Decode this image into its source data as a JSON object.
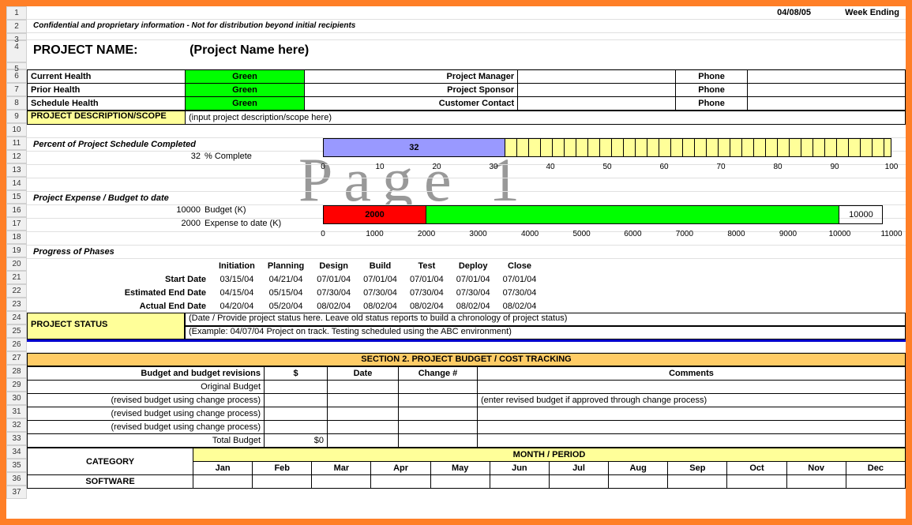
{
  "header": {
    "date": "04/08/05",
    "week_ending": "Week Ending",
    "confidential": "Confidential and proprietary information - Not for distribution beyond initial recipients",
    "project_name_label": "PROJECT NAME:",
    "project_name_value": "(Project Name here)"
  },
  "health": {
    "rows": [
      {
        "label": "Current Health",
        "value": "Green",
        "r_label": "Project Manager",
        "phone": "Phone"
      },
      {
        "label": "Prior Health",
        "value": "Green",
        "r_label": "Project Sponsor",
        "phone": "Phone"
      },
      {
        "label": "Schedule Health",
        "value": "Green",
        "r_label": "Customer Contact",
        "phone": "Phone"
      }
    ]
  },
  "description": {
    "label": "PROJECT DESCRIPTION/SCOPE",
    "value": "(input project description/scope here)"
  },
  "schedule": {
    "label": "Percent of Project Schedule Completed",
    "percent": "32",
    "complete_label": "% Complete",
    "ticks": [
      "0",
      "10",
      "20",
      "30",
      "40",
      "50",
      "60",
      "70",
      "80",
      "90",
      "100"
    ]
  },
  "budget": {
    "label": "Project Expense / Budget to date",
    "budget_val": "10000",
    "budget_lbl": "Budget (K)",
    "expense_val": "2000",
    "expense_lbl": "Expense to date (K)",
    "bar_exp": "2000",
    "bar_bud": "10000",
    "ticks": [
      "0",
      "1000",
      "2000",
      "3000",
      "4000",
      "5000",
      "6000",
      "7000",
      "8000",
      "9000",
      "10000",
      "11000"
    ]
  },
  "phases": {
    "label": "Progress of Phases",
    "headers": [
      "Initiation",
      "Planning",
      "Design",
      "Build",
      "Test",
      "Deploy",
      "Close"
    ],
    "rows": [
      {
        "label": "Start Date",
        "vals": [
          "03/15/04",
          "04/21/04",
          "07/01/04",
          "07/01/04",
          "07/01/04",
          "07/01/04",
          "07/01/04"
        ]
      },
      {
        "label": "Estimated End Date",
        "vals": [
          "04/15/04",
          "05/15/04",
          "07/30/04",
          "07/30/04",
          "07/30/04",
          "07/30/04",
          "07/30/04"
        ]
      },
      {
        "label": "Actual End Date",
        "vals": [
          "04/20/04",
          "05/20/04",
          "08/02/04",
          "08/02/04",
          "08/02/04",
          "08/02/04",
          "08/02/04"
        ]
      }
    ]
  },
  "status": {
    "label": "PROJECT STATUS",
    "line1": "(Date / Provide project status here.  Leave old status reports to build a chronology of project status)",
    "line2": "(Example:  04/07/04 Project on track.  Testing scheduled using the ABC environment)"
  },
  "section2": {
    "title": "SECTION 2.  PROJECT BUDGET / COST TRACKING",
    "headers": {
      "a": "Budget and budget revisions",
      "b": "$",
      "c": "Date",
      "d": "Change #",
      "e": "Comments"
    },
    "rows": [
      {
        "label": "Original Budget"
      },
      {
        "label": "(revised budget using change process)",
        "comment": "(enter revised budget if approved through change process)"
      },
      {
        "label": "(revised budget using change process)"
      },
      {
        "label": "(revised budget using change process)"
      },
      {
        "label": "Total Budget",
        "amount": "$0"
      }
    ]
  },
  "months": {
    "period_label": "MONTH / PERIOD",
    "category_label": "CATEGORY",
    "items": [
      "Jan",
      "Feb",
      "Mar",
      "Apr",
      "May",
      "Jun",
      "Jul",
      "Aug",
      "Sep",
      "Oct",
      "Nov",
      "Dec"
    ],
    "software": "SOFTWARE"
  },
  "watermark": "Page 1",
  "row_numbers": [
    "1",
    "2",
    "3",
    "4",
    "5",
    "6",
    "7",
    "8",
    "9",
    "10",
    "11",
    "12",
    "13",
    "14",
    "15",
    "16",
    "17",
    "18",
    "19",
    "20",
    "21",
    "22",
    "23",
    "24",
    "25",
    "26",
    "27",
    "28",
    "29",
    "30",
    "31",
    "32",
    "33",
    "34",
    "35",
    "36",
    "37"
  ],
  "chart_data": [
    {
      "type": "bar",
      "title": "Percent of Project Schedule Completed",
      "categories": [
        "% Complete"
      ],
      "values": [
        32
      ],
      "xlabel": "",
      "ylabel": "",
      "ylim": [
        0,
        100
      ]
    },
    {
      "type": "bar",
      "title": "Project Expense / Budget to date",
      "series": [
        {
          "name": "Expense to date (K)",
          "values": [
            2000
          ]
        },
        {
          "name": "Budget (K)",
          "values": [
            10000
          ]
        }
      ],
      "xlabel": "",
      "ylabel": "",
      "ylim": [
        0,
        11000
      ]
    }
  ]
}
